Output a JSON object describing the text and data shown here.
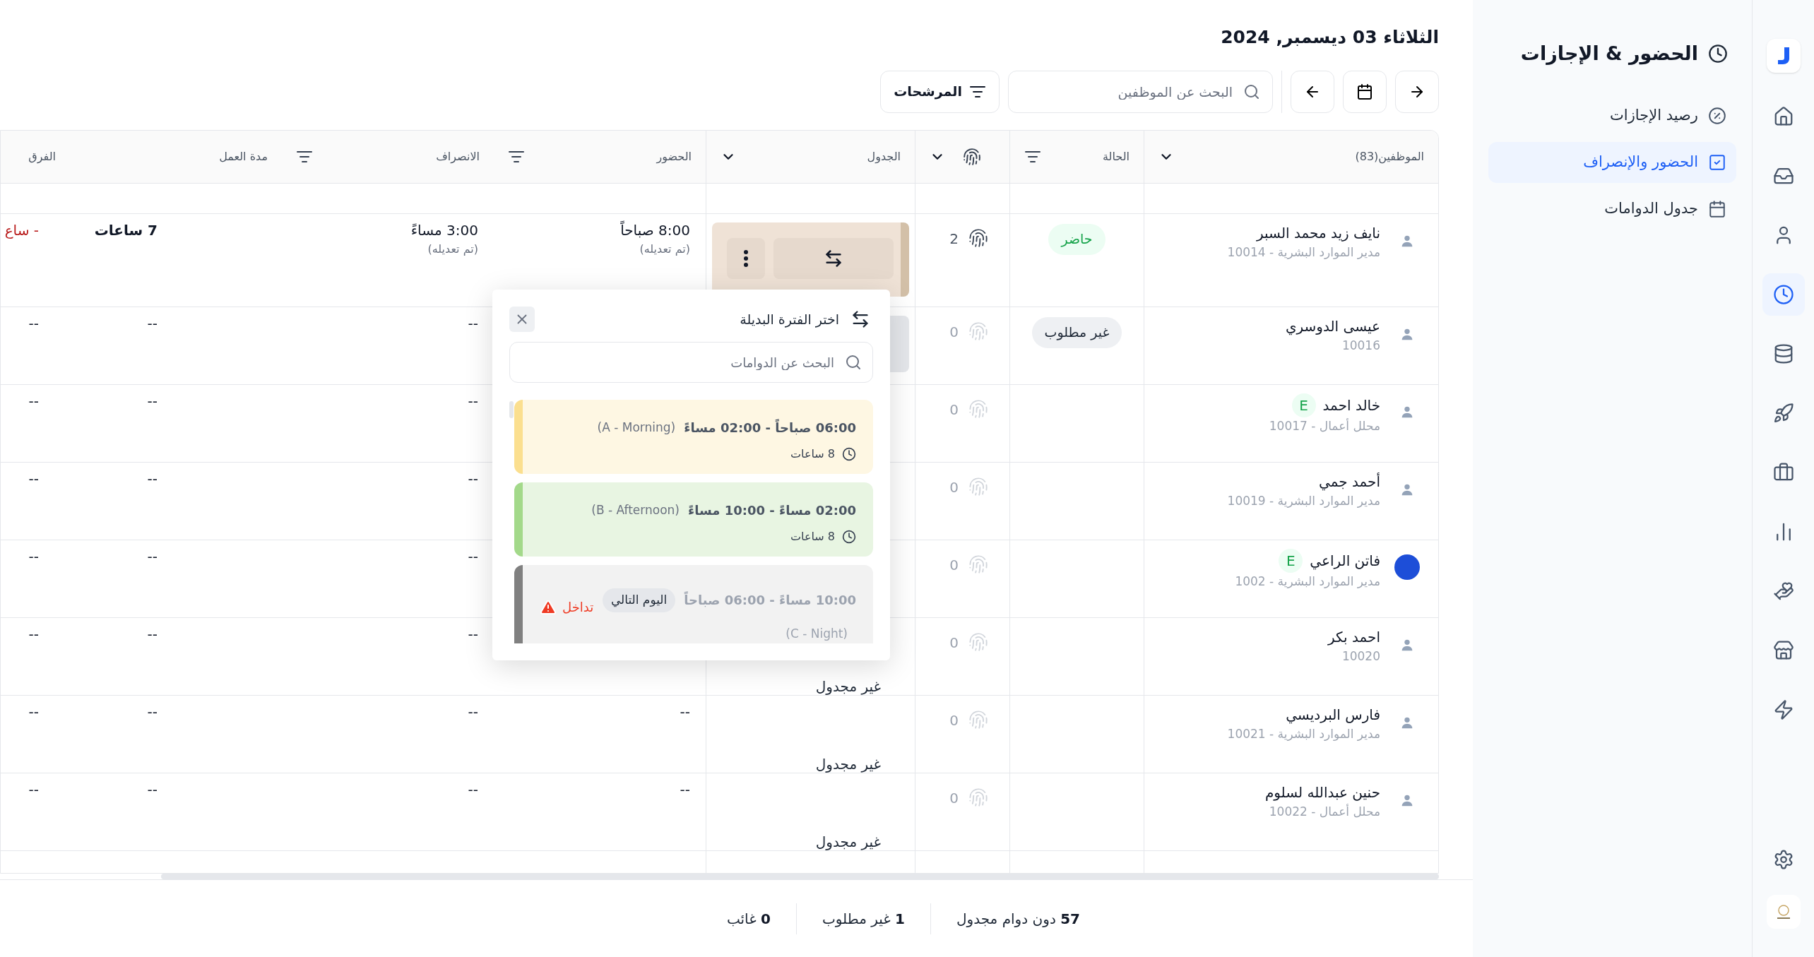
{
  "rail": {
    "items": [
      {
        "kind": "home",
        "selected": false
      },
      {
        "kind": "inbox",
        "selected": false
      },
      {
        "kind": "user",
        "selected": false
      },
      {
        "kind": "clock",
        "selected": true
      },
      {
        "kind": "database",
        "selected": false
      },
      {
        "kind": "rocket",
        "selected": false
      },
      {
        "kind": "briefcase",
        "selected": false
      },
      {
        "kind": "chart",
        "selected": false
      },
      {
        "kind": "hand-heart",
        "selected": false
      },
      {
        "kind": "store",
        "selected": false
      },
      {
        "kind": "zap",
        "selected": false
      }
    ]
  },
  "sidebar": {
    "title": "الحضور & الإجازات",
    "items": [
      {
        "label": "رصيد الإجازات",
        "kind": "percent",
        "selected": false
      },
      {
        "label": "الحضور والإنصراف",
        "kind": "check",
        "selected": true
      },
      {
        "label": "جدول الدوامات",
        "kind": "calendar",
        "selected": false
      }
    ]
  },
  "date_title": "الثلاثاء 03 ديسمبر, 2024",
  "toolbar": {
    "search": {
      "placeholder": "البحث عن الموظفين"
    },
    "filters_button": "المرشحات"
  },
  "table": {
    "columns": [
      {
        "label": "الموظفين(83)",
        "kind": "chevron"
      },
      {
        "label": "الحالة",
        "kind": "filter"
      },
      {
        "kind": "fingerprint"
      },
      {
        "label": "الجدول",
        "kind": "chevron"
      },
      {
        "label": "الحضور",
        "kind": "filter"
      },
      {
        "label": "الانصراف",
        "kind": "filter"
      },
      {
        "label": "مدة العمل",
        "kind": "plain"
      },
      {
        "label": "الفرق",
        "kind": "plain"
      }
    ],
    "rows": [
      {
        "name": "نايف زيد محمد السبر",
        "subtitle": "مدير الموارد البشرية - 10014",
        "avatar": {
          "kind": "person"
        },
        "status": {
          "label": "حاضر",
          "kind": "present"
        },
        "punches": "2",
        "punched": true,
        "schedule": {
          "kind": "shift"
        },
        "attendance": "8:00 صباحاً",
        "attendance_note": "(تم تعديله)",
        "departure": "3:00 مساءً",
        "departure_note": "(تم تعديله)",
        "duration": "7 ساعات",
        "difference": "- ساع",
        "negative": true
      },
      {
        "name": "عيسى الدوسري",
        "subtitle": "10016",
        "avatar": {
          "kind": "person"
        },
        "status": {
          "label": "غير مطلوب",
          "kind": "not-required"
        },
        "punches": "0",
        "punched": false,
        "schedule": {
          "kind": "blank"
        },
        "departure": "--",
        "duration": "--",
        "difference": "--",
        "negative": false
      },
      {
        "name": "خالد احمد",
        "badge": "E",
        "subtitle": "محلل أعمال - 10017",
        "avatar": {
          "kind": "person"
        },
        "punches": "0",
        "punched": false,
        "schedule": {
          "kind": "hidden"
        },
        "departure": "--",
        "duration": "--",
        "difference": "--",
        "negative": false
      },
      {
        "name": "أحمد جمي",
        "subtitle": "مدير الموارد البشرية - 10019",
        "avatar": {
          "kind": "person"
        },
        "punches": "0",
        "punched": false,
        "schedule": {
          "kind": "hidden"
        },
        "departure": "--",
        "duration": "--",
        "difference": "--",
        "negative": false
      },
      {
        "name": "فاتن الراعي",
        "badge": "E",
        "subtitle": "مدير الموارد البشرية - 1002",
        "avatar": {
          "kind": "logo"
        },
        "punches": "0",
        "punched": false,
        "schedule": {
          "kind": "hidden"
        },
        "departure": "--",
        "duration": "--",
        "difference": "--",
        "negative": false
      },
      {
        "name": "احمد بكر",
        "subtitle": "10020",
        "avatar": {
          "kind": "person"
        },
        "punches": "0",
        "punched": false,
        "schedule": {
          "kind": "unscheduled",
          "label": "غير مجدول"
        },
        "departure": "--",
        "duration": "--",
        "difference": "--",
        "negative": false
      },
      {
        "name": "فارس البرديسي",
        "subtitle": "مدير الموارد البشرية - 10021",
        "avatar": {
          "kind": "person"
        },
        "punches": "0",
        "punched": false,
        "schedule": {
          "kind": "unscheduled",
          "label": "غير مجدول"
        },
        "attendance": "--",
        "departure": "--",
        "duration": "--",
        "difference": "--",
        "negative": false
      },
      {
        "name": "حنين عبدالله لسلوم",
        "subtitle": "محلل أعمال - 10022",
        "avatar": {
          "kind": "person"
        },
        "punches": "0",
        "punched": false,
        "schedule": {
          "kind": "unscheduled",
          "label": "غير مجدول"
        },
        "attendance": "--",
        "departure": "--",
        "duration": "--",
        "difference": "--",
        "negative": false
      }
    ]
  },
  "popup": {
    "title": "اختر الفترة البديلة",
    "search": {
      "placeholder": "البحث عن الدوامات"
    },
    "shifts": [
      {
        "kind": "available",
        "time": "06:00 صباحاً - 02:00 مساءً",
        "name": "(A - Morning)",
        "hours": "8 ساعات",
        "color": "#fbdf8f"
      },
      {
        "kind": "available",
        "time": "02:00 مساءً - 10:00 مساءً",
        "name": "(B - Afternoon)",
        "hours": "8 ساعات",
        "color": "#a3d98a"
      },
      {
        "kind": "conflict",
        "time": "10:00 مساءً - 06:00 صباحاً",
        "tag": "اليوم التالي",
        "warning": "تداخل",
        "name": "(C - Night)",
        "color": "#808080"
      }
    ]
  },
  "footer": {
    "stats": [
      {
        "count": "57",
        "label": "دون دوام مجدول"
      },
      {
        "count": "1",
        "label": "غير مطلوب"
      },
      {
        "count": "0",
        "label": "غائب"
      }
    ]
  }
}
